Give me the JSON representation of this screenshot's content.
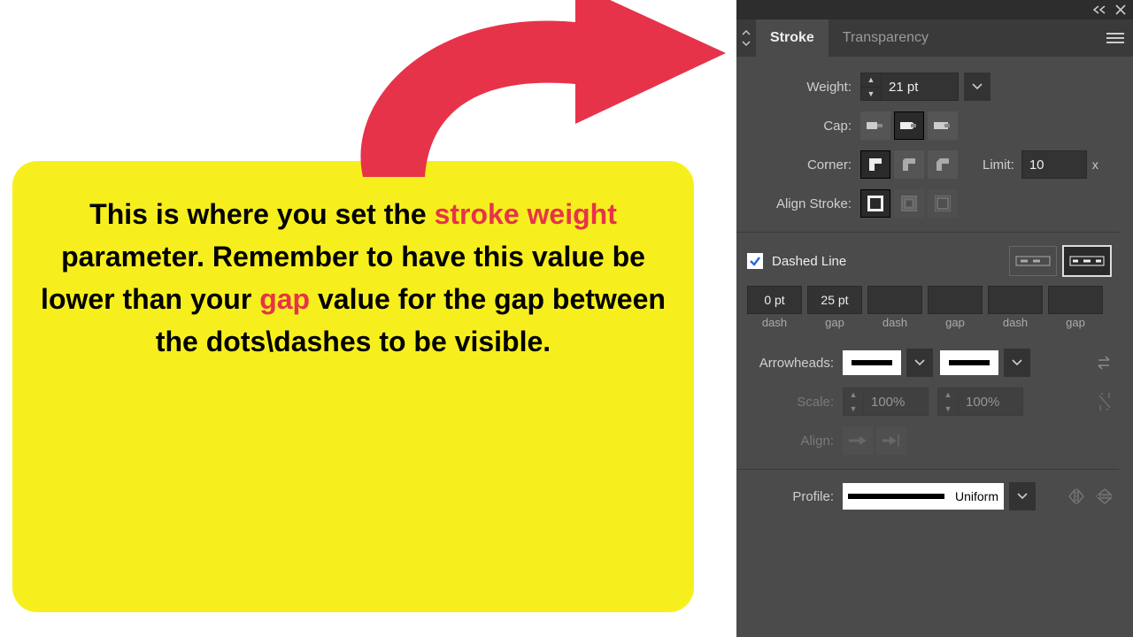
{
  "callout": {
    "pre": "This is where you set the ",
    "hl1": "stroke weight",
    "mid": " parameter. Remember to have this value be lower than your ",
    "hl2": "gap",
    "post": " value for the gap between the dots\\dashes to be visible."
  },
  "panel": {
    "tab_stroke": "Stroke",
    "tab_transparency": "Transparency",
    "weight_label": "Weight:",
    "weight_value": "21 pt",
    "cap_label": "Cap:",
    "corner_label": "Corner:",
    "limit_label": "Limit:",
    "limit_value": "10",
    "limit_suffix": "x",
    "align_label": "Align Stroke:",
    "dashed_label": "Dashed Line",
    "dash_values": [
      "0 pt",
      "25 pt",
      "",
      "",
      "",
      ""
    ],
    "dash_col_labels": [
      "dash",
      "gap",
      "dash",
      "gap",
      "dash",
      "gap"
    ],
    "arrowheads_label": "Arrowheads:",
    "scale_label": "Scale:",
    "scale_value_1": "100%",
    "scale_value_2": "100%",
    "align_arrow_label": "Align:",
    "profile_label": "Profile:",
    "profile_value": "Uniform"
  }
}
